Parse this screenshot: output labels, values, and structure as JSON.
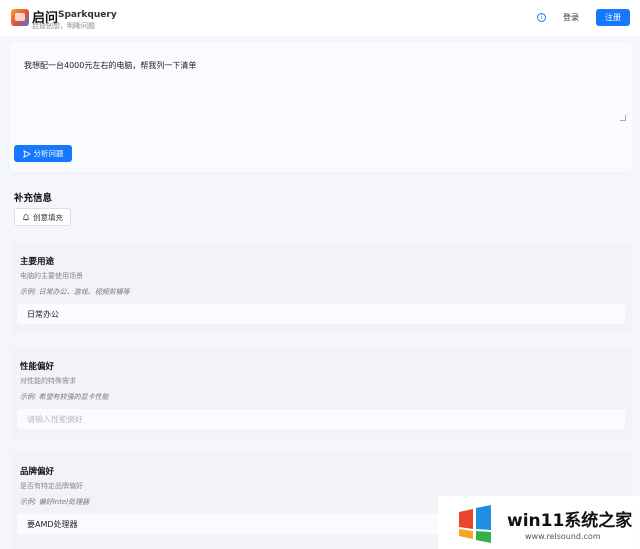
{
  "header": {
    "brand_cn": "启问",
    "brand_en": "Sparkquery",
    "slogan": "启迪创想，明晰问题",
    "login_label": "登录",
    "register_label": "注册",
    "info_icon": "info-circle-icon"
  },
  "question": {
    "text": "我想配一台4000元左右的电脑，帮我列一下清单",
    "analyze_label": "分析问题"
  },
  "supplement": {
    "title": "补充信息",
    "smart_fill_label": "创意填充",
    "sections": [
      {
        "title": "主要用途",
        "description": "电脑的主要使用场景",
        "example": "示例: 日常办公、游戏、视频剪辑等",
        "value": "日常办公",
        "placeholder": ""
      },
      {
        "title": "性能偏好",
        "description": "对性能的特殊需求",
        "example": "示例: 希望有较强的显卡性能",
        "value": "",
        "placeholder": "请输入性能偏好"
      },
      {
        "title": "品牌偏好",
        "description": "是否有特定品牌偏好",
        "example": "示例: 偏好Intel处理器",
        "value": "要AMD处理器",
        "placeholder": ""
      }
    ]
  },
  "watermark": {
    "main": "win11系统之家",
    "url": "www.relsound.com"
  },
  "colors": {
    "accent": "#1677ff",
    "page_bg": "#f5f6fb",
    "section_bg": "#f2f3f9"
  }
}
